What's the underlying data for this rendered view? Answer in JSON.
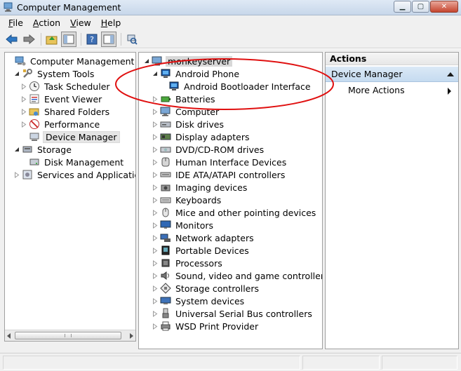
{
  "window": {
    "title": "Computer Management",
    "controls": {
      "minimize_icon": "minimize-icon",
      "maximize_icon": "maximize-icon",
      "close_icon": "close-icon"
    }
  },
  "menu": [
    {
      "id": "file",
      "label": "File"
    },
    {
      "id": "action",
      "label": "Action"
    },
    {
      "id": "view",
      "label": "View"
    },
    {
      "id": "help",
      "label": "Help"
    }
  ],
  "toolbar": [
    {
      "id": "back",
      "icon": "back-arrow-icon"
    },
    {
      "id": "forward",
      "icon": "forward-arrow-icon"
    },
    {
      "id": "up",
      "icon": "up-folder-icon"
    },
    {
      "id": "show-hide-tree",
      "icon": "console-tree-icon"
    },
    {
      "id": "help",
      "icon": "help-icon"
    },
    {
      "id": "show-hide-action",
      "icon": "action-pane-icon"
    },
    {
      "id": "scan-hardware",
      "icon": "scan-hardware-icon"
    }
  ],
  "left_tree": {
    "root": {
      "label": "Computer Management (Local",
      "icon": "computer-management-icon"
    },
    "items": [
      {
        "label": "System Tools",
        "icon": "system-tools-icon",
        "level": 1,
        "expander": "open"
      },
      {
        "label": "Task Scheduler",
        "icon": "task-scheduler-icon",
        "level": 2,
        "expander": "closed"
      },
      {
        "label": "Event Viewer",
        "icon": "event-viewer-icon",
        "level": 2,
        "expander": "closed"
      },
      {
        "label": "Shared Folders",
        "icon": "shared-folders-icon",
        "level": 2,
        "expander": "closed"
      },
      {
        "label": "Performance",
        "icon": "performance-icon",
        "level": 2,
        "expander": "closed"
      },
      {
        "label": "Device Manager",
        "icon": "device-manager-icon",
        "level": 2,
        "expander": "none",
        "selected": true
      },
      {
        "label": "Storage",
        "icon": "storage-icon",
        "level": 1,
        "expander": "open"
      },
      {
        "label": "Disk Management",
        "icon": "disk-management-icon",
        "level": 2,
        "expander": "none"
      },
      {
        "label": "Services and Applications",
        "icon": "services-icon",
        "level": 1,
        "expander": "closed"
      }
    ]
  },
  "device_tree": {
    "root": {
      "label": "monkeyserver",
      "icon": "computer-icon"
    },
    "items": [
      {
        "label": "Android Phone",
        "icon": "android-phone-icon",
        "level": 1,
        "expander": "open"
      },
      {
        "label": "Android Bootloader Interface",
        "icon": "android-bootloader-icon",
        "level": 2,
        "expander": "none"
      },
      {
        "label": "Batteries",
        "icon": "batteries-icon",
        "level": 1,
        "expander": "closed"
      },
      {
        "label": "Computer",
        "icon": "computer-icon",
        "level": 1,
        "expander": "closed"
      },
      {
        "label": "Disk drives",
        "icon": "disk-drive-icon",
        "level": 1,
        "expander": "closed"
      },
      {
        "label": "Display adapters",
        "icon": "display-adapter-icon",
        "level": 1,
        "expander": "closed"
      },
      {
        "label": "DVD/CD-ROM drives",
        "icon": "dvd-drive-icon",
        "level": 1,
        "expander": "closed"
      },
      {
        "label": "Human Interface Devices",
        "icon": "hid-icon",
        "level": 1,
        "expander": "closed"
      },
      {
        "label": "IDE ATA/ATAPI controllers",
        "icon": "ide-controller-icon",
        "level": 1,
        "expander": "closed"
      },
      {
        "label": "Imaging devices",
        "icon": "imaging-device-icon",
        "level": 1,
        "expander": "closed"
      },
      {
        "label": "Keyboards",
        "icon": "keyboard-icon",
        "level": 1,
        "expander": "closed"
      },
      {
        "label": "Mice and other pointing devices",
        "icon": "mouse-icon",
        "level": 1,
        "expander": "closed"
      },
      {
        "label": "Monitors",
        "icon": "monitor-icon",
        "level": 1,
        "expander": "closed"
      },
      {
        "label": "Network adapters",
        "icon": "network-adapter-icon",
        "level": 1,
        "expander": "closed"
      },
      {
        "label": "Portable Devices",
        "icon": "portable-device-icon",
        "level": 1,
        "expander": "closed"
      },
      {
        "label": "Processors",
        "icon": "processor-icon",
        "level": 1,
        "expander": "closed"
      },
      {
        "label": "Sound, video and game controllers",
        "icon": "sound-icon",
        "level": 1,
        "expander": "closed"
      },
      {
        "label": "Storage controllers",
        "icon": "storage-controller-icon",
        "level": 1,
        "expander": "closed"
      },
      {
        "label": "System devices",
        "icon": "system-device-icon",
        "level": 1,
        "expander": "closed"
      },
      {
        "label": "Universal Serial Bus controllers",
        "icon": "usb-icon",
        "level": 1,
        "expander": "closed"
      },
      {
        "label": "WSD Print Provider",
        "icon": "printer-icon",
        "level": 1,
        "expander": "closed"
      }
    ]
  },
  "actions_pane": {
    "header": "Actions",
    "section": "Device Manager",
    "more_actions": "More Actions"
  },
  "colors": {
    "annotation": "#e01010",
    "selection_bg": "#e5e5e5",
    "section_bg": "#cfe1f3"
  }
}
